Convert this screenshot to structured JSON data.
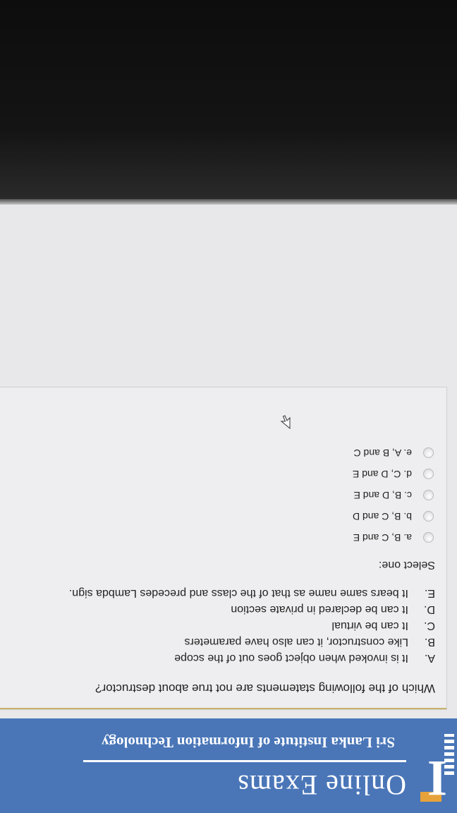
{
  "header": {
    "title": "Online Exams",
    "subtitle": "Sri Lanka Institute of Information Technology",
    "colors": {
      "bar": "#4a76b8",
      "logo_band": "#e8a23a"
    }
  },
  "question": {
    "text": "Which of the following statements are not true about destructor?",
    "statements": [
      {
        "letter": "A.",
        "text": "It is invoked when object goes out of the scope"
      },
      {
        "letter": "B.",
        "text": "Like constructor, it can also have parameters"
      },
      {
        "letter": "C.",
        "text": "It can be virtual"
      },
      {
        "letter": "D.",
        "text": "It can be declared in private section"
      },
      {
        "letter": "E.",
        "text": "It bears same name as that of the class and precedes Lambda sign."
      }
    ],
    "select_label": "Select one:",
    "options": [
      {
        "label": "a. B, C and E"
      },
      {
        "label": "b. B, C and D"
      },
      {
        "label": "c. B, D and E"
      },
      {
        "label": "d. C, D and E"
      },
      {
        "label": "e. A, B and C"
      }
    ]
  },
  "icons": {
    "logo": "institute-logo-icon",
    "cursor": "mouse-pointer-icon",
    "radio": "radio-unchecked-icon"
  }
}
